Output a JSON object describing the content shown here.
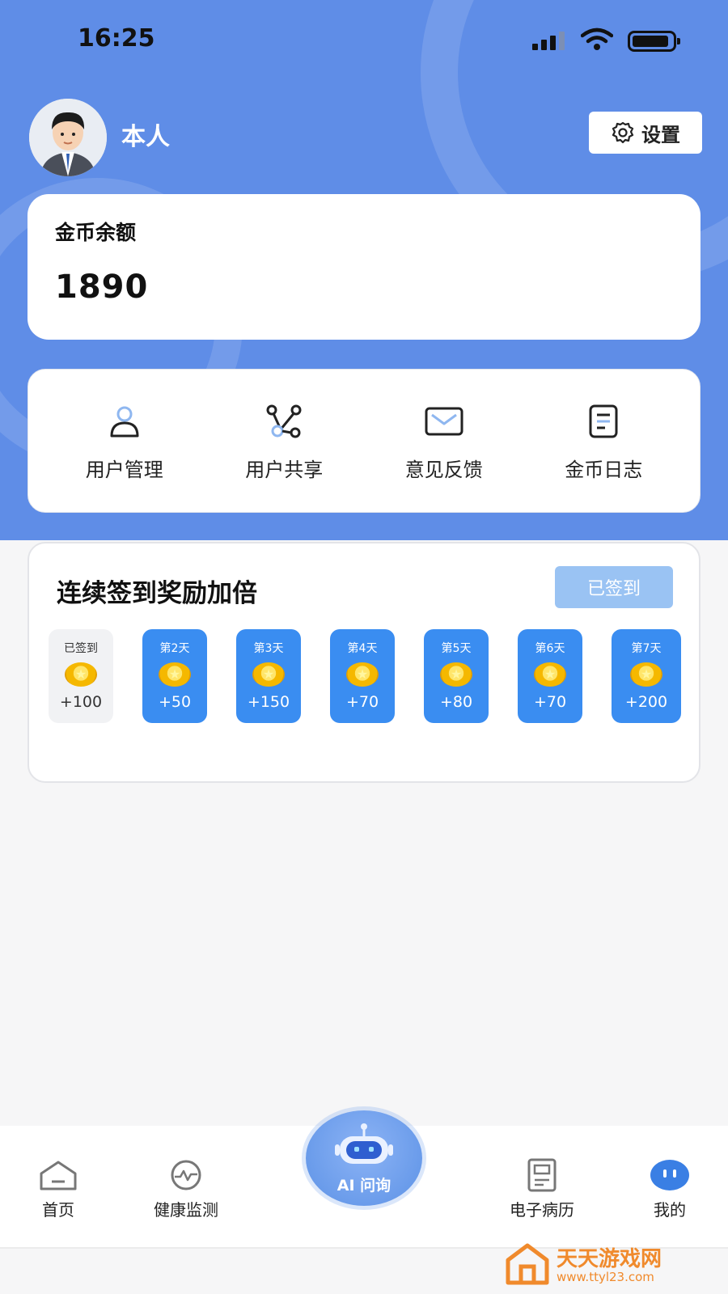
{
  "status_bar": {
    "time": "16:25"
  },
  "profile": {
    "username": "本人",
    "settings_label": "设置"
  },
  "balance": {
    "label": "金币余额",
    "value": "1890"
  },
  "menu": [
    {
      "label": "用户管理",
      "icon": "person-icon"
    },
    {
      "label": "用户共享",
      "icon": "share-icon"
    },
    {
      "label": "意见反馈",
      "icon": "mail-icon"
    },
    {
      "label": "金币日志",
      "icon": "document-icon"
    }
  ],
  "signin": {
    "title": "连续签到奖励加倍",
    "button_label": "已签到",
    "days": [
      {
        "label": "已签到",
        "bonus": "+100",
        "done": true
      },
      {
        "label": "第2天",
        "bonus": "+50",
        "done": false
      },
      {
        "label": "第3天",
        "bonus": "+150",
        "done": false
      },
      {
        "label": "第4天",
        "bonus": "+70",
        "done": false
      },
      {
        "label": "第5天",
        "bonus": "+80",
        "done": false
      },
      {
        "label": "第6天",
        "bonus": "+70",
        "done": false
      },
      {
        "label": "第7天",
        "bonus": "+200",
        "done": false
      }
    ]
  },
  "tabbar": {
    "tabs": [
      {
        "label": "首页",
        "icon": "home-icon"
      },
      {
        "label": "健康监测",
        "icon": "heartbeat-icon"
      },
      {
        "label": "电子病历",
        "icon": "record-icon"
      },
      {
        "label": "我的",
        "icon": "profile-icon"
      }
    ],
    "ai_label": "AI 问询"
  },
  "watermark": {
    "brand": "天天游戏网",
    "url": "www.ttyl23.com"
  },
  "colors": {
    "primary": "#5f8de7",
    "day_active": "#3a8df1",
    "button_disabled": "#9ac3f3",
    "coin": "#f5b800"
  }
}
